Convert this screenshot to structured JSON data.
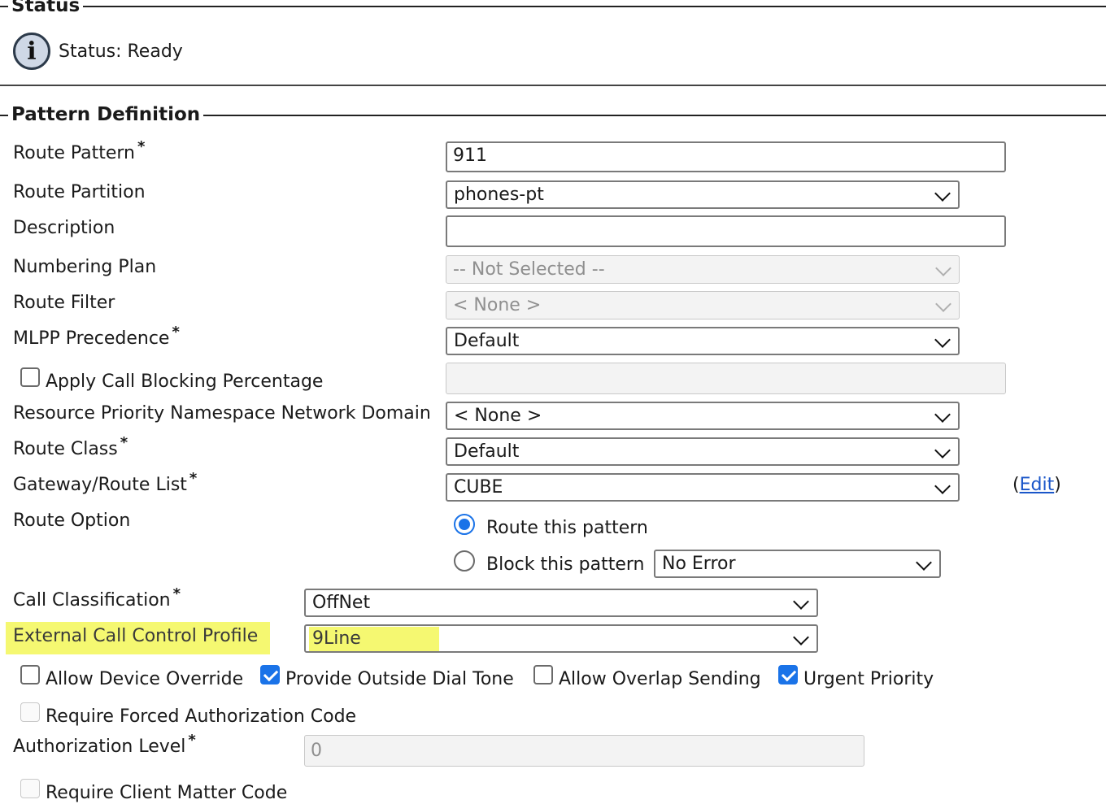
{
  "status": {
    "legend": "Status",
    "icon": "info-icon",
    "text": "Status: Ready"
  },
  "pattern": {
    "legend": "Pattern Definition",
    "route_pattern": {
      "label": "Route Pattern",
      "required": "*",
      "value": "911"
    },
    "route_partition": {
      "label": "Route Partition",
      "value": "phones-pt"
    },
    "description": {
      "label": "Description",
      "value": ""
    },
    "numbering_plan": {
      "label": "Numbering Plan",
      "value": "-- Not Selected --"
    },
    "route_filter": {
      "label": "Route Filter",
      "value": "< None >"
    },
    "mlpp_precedence": {
      "label": "MLPP Precedence",
      "required": "*",
      "value": "Default"
    },
    "apply_call_blocking": {
      "label": "Apply Call Blocking Percentage",
      "checked": false,
      "value": ""
    },
    "resource_priority": {
      "label": "Resource Priority Namespace Network Domain",
      "value": "< None >"
    },
    "route_class": {
      "label": "Route Class",
      "required": "*",
      "value": "Default"
    },
    "gateway_route_list": {
      "label": "Gateway/Route List",
      "required": "*",
      "value": "CUBE",
      "edit_open": "(",
      "edit_link": "Edit",
      "edit_close": ")"
    },
    "route_option": {
      "label": "Route Option",
      "route_this": "Route this pattern",
      "block_this": "Block this pattern",
      "block_reason": "No Error",
      "selected": "route"
    },
    "call_classification": {
      "label": "Call Classification",
      "required": "*",
      "value": "OffNet"
    },
    "external_call_control": {
      "label": "External Call Control Profile",
      "value": "9Line",
      "highlight_color": "#f2f542"
    },
    "allow_device_override": {
      "label": "Allow Device Override",
      "checked": false
    },
    "provide_outside_dial_tone": {
      "label": "Provide Outside Dial Tone",
      "checked": true
    },
    "allow_overlap_sending": {
      "label": "Allow Overlap Sending",
      "checked": false
    },
    "urgent_priority": {
      "label": "Urgent Priority",
      "checked": true
    },
    "require_forced_auth": {
      "label": "Require Forced Authorization Code",
      "checked": false
    },
    "authorization_level": {
      "label": "Authorization Level",
      "required": "*",
      "value": "0"
    },
    "require_client_matter": {
      "label": "Require Client Matter Code",
      "checked": false
    }
  },
  "colors": {
    "accent": "#1a73e8",
    "link": "#1a56c9",
    "highlight": "#f2f542"
  }
}
